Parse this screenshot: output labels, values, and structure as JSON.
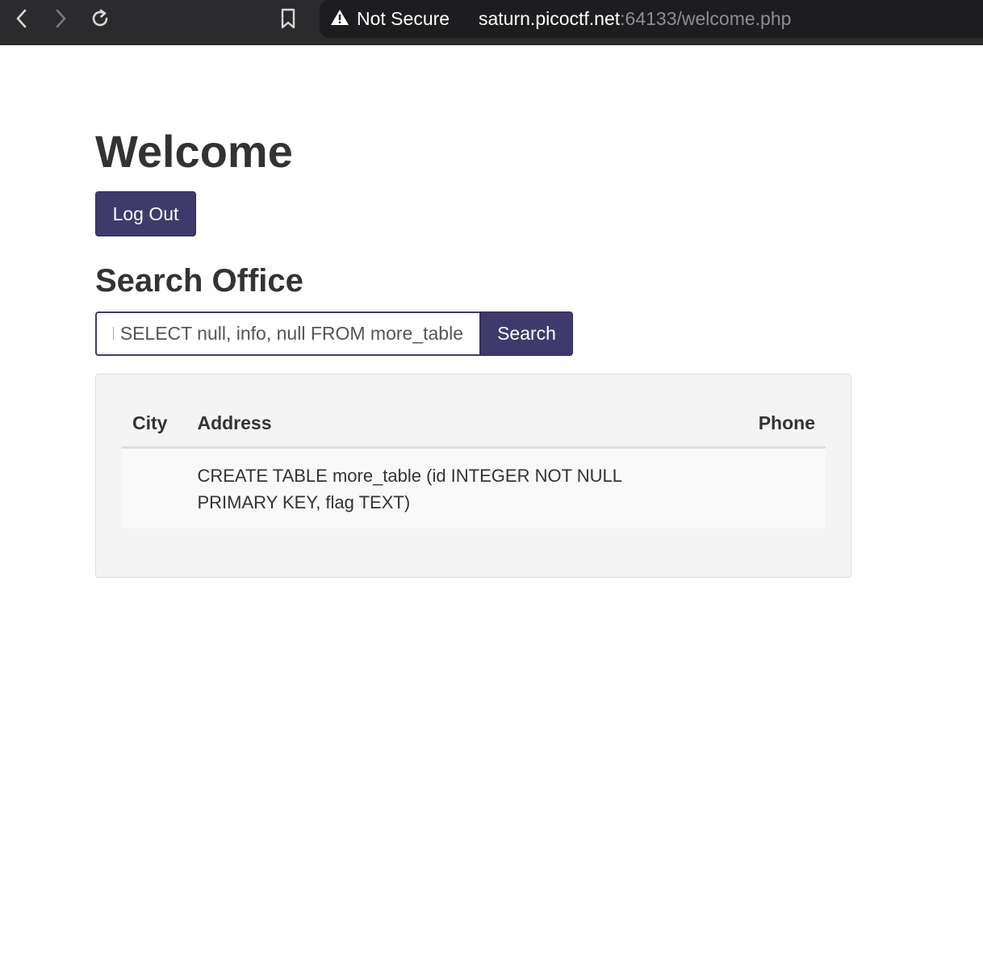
{
  "browser": {
    "security_label": "Not Secure",
    "url_host": "saturn.picoctf.net",
    "url_rest": ":64133/welcome.php",
    "icons": [
      "back-icon",
      "forward-icon",
      "reload-icon",
      "bookmark-icon",
      "warning-icon"
    ]
  },
  "page": {
    "title": "Welcome",
    "logout_label": "Log Out",
    "search_heading": "Search Office",
    "search_value": "N SELECT null, info, null FROM more_table",
    "search_button": "Search"
  },
  "table": {
    "headers": [
      "City",
      "Address",
      "Phone"
    ],
    "rows": [
      {
        "city": "",
        "address": "CREATE TABLE more_table (id INTEGER NOT NULL PRIMARY KEY, flag TEXT)",
        "phone": ""
      }
    ]
  },
  "colors": {
    "accent": "#3f3a6b",
    "toolbar": "#2b2b2d"
  }
}
